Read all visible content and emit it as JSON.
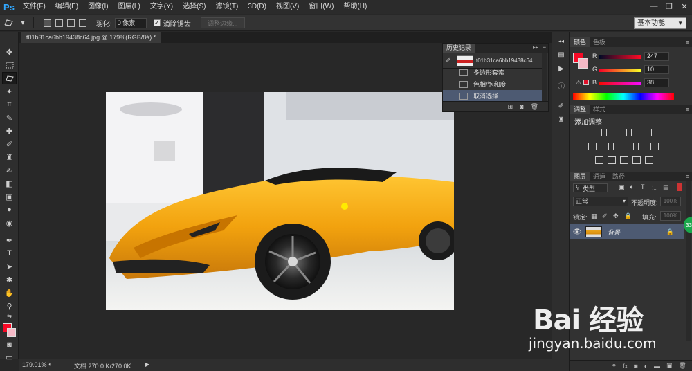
{
  "app": {
    "logo": "Ps"
  },
  "menu": [
    "文件(F)",
    "编辑(E)",
    "图像(I)",
    "图层(L)",
    "文字(Y)",
    "选择(S)",
    "滤镜(T)",
    "3D(D)",
    "视图(V)",
    "窗口(W)",
    "帮助(H)"
  ],
  "window_controls": {
    "minimize": "—",
    "restore": "❐",
    "close": "✕"
  },
  "options": {
    "feather_label": "羽化:",
    "feather_value": "0 像素",
    "antialias_label": "消除锯齿",
    "antialias_checked": true,
    "refine_edge": "调整边缘...",
    "workspace": "基本功能"
  },
  "document": {
    "tab_title": "t01b31ca6bb19438c64.jpg @ 179%(RGB/8#) *"
  },
  "status": {
    "zoom": "179.01%",
    "doc_size": "文档:270.0 K/270.0K"
  },
  "history": {
    "title": "历史记录",
    "snapshot_name": "t01b31ca6bb19438c64...",
    "items": [
      {
        "label": "多边形套索",
        "selected": false
      },
      {
        "label": "色相/饱和度",
        "selected": false
      },
      {
        "label": "取消选择",
        "selected": true
      }
    ]
  },
  "color_panel": {
    "tabs": [
      "颜色",
      "色板"
    ],
    "foreground": "#f70a26",
    "background": "#f5b9c6",
    "channels": [
      {
        "label": "R",
        "value": "247"
      },
      {
        "label": "G",
        "value": "10"
      },
      {
        "label": "B",
        "value": "38"
      }
    ]
  },
  "adjustments": {
    "tabs": [
      "调整",
      "样式"
    ],
    "title": "添加调整"
  },
  "layers": {
    "tabs": [
      "图层",
      "通道",
      "路径"
    ],
    "filter_label": "类型",
    "blend_mode": "正常",
    "opacity_label": "不透明度:",
    "opacity_value": "100%",
    "lock_label": "锁定:",
    "fill_label": "填充:",
    "fill_value": "100%",
    "layer_name": "背景"
  },
  "badge": "33",
  "watermark": {
    "logo": "Bai 经验",
    "url": "jingyan.baidu.com"
  }
}
